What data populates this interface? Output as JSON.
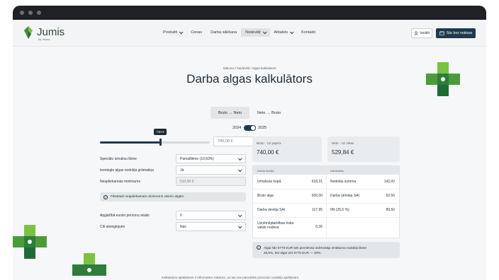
{
  "colors": {
    "navy": "#1e3a4c",
    "green_light": "#7cc242",
    "green_mid": "#4a9c3a",
    "green_dark": "#1f6b35"
  },
  "header": {
    "logo_text": "Jumis",
    "logo_sub": "by Visma",
    "nav": [
      {
        "label": "Produkti",
        "dropdown": true,
        "active": false
      },
      {
        "label": "Cenas",
        "dropdown": false,
        "active": false
      },
      {
        "label": "Darba sākšana",
        "dropdown": false,
        "active": false
      },
      {
        "label": "Nodevēļi",
        "dropdown": true,
        "active": true
      },
      {
        "label": "Atbalsts",
        "dropdown": true,
        "active": false
      },
      {
        "label": "Kontakti",
        "dropdown": false,
        "active": false
      }
    ],
    "login_label": "Ienākt",
    "cta_label": "Sāc bez maksas"
  },
  "hero": {
    "breadcrumb": "Sākums / Nodevēļi / Algas kalkulators",
    "title": "Darba algas kalkulātors"
  },
  "mode": {
    "options": [
      "Bruto → Neto",
      "Neto → Bruto"
    ],
    "selected": 0
  },
  "year_toggle": {
    "left": "2024",
    "right": "2025",
    "on_right": true
  },
  "slider": {
    "bubble": "740 €",
    "fraction": 0.55,
    "input_value": "740,00 €"
  },
  "form": [
    {
      "label": "Speciālo izmaksu likme",
      "value": "Pamatlikme (10,50%)",
      "disabled": false
    },
    {
      "label": "Iesniegts algas nodokļa grāmatiņa",
      "value": "Jā",
      "disabled": false
    },
    {
      "label": "Neapliekamais minimums",
      "value": "510,00 €",
      "disabled": true
    }
  ],
  "form_note": "Fiksētais neapliekamais minimums visiem algām.",
  "form2": [
    {
      "label": "Apgādībā esošo personu skaits",
      "value": "0"
    },
    {
      "label": "Citi atvieglojumi",
      "value": "Nav"
    }
  ],
  "cards": [
    {
      "label": "Bruto · Uz papīra",
      "value": "740,00 €"
    },
    {
      "label": "Neto · Uz rokas",
      "value": "529,84 €"
    }
  ],
  "table": {
    "head_left": "Darba devējs",
    "head_right": "Darbinieks",
    "rows": [
      {
        "l_label": "Izmaksas kopā",
        "l_value": "618,31",
        "r_label": "Nodokļu summa",
        "r_value": "142,00"
      },
      {
        "l_label": "Bruto alga",
        "l_value": "500,00",
        "r_label": "Darba ņēmēja SAI",
        "r_value": "52,50"
      },
      {
        "l_label": "Darba devēja SAI",
        "l_value": "117,95",
        "r_label": "IIN (25,5 %)",
        "r_value": "89,50"
      },
      {
        "l_label": "Uzņēmējdarbības riska valsts nodeva",
        "l_value": "0,36",
        "r_label": "",
        "r_value": ""
      }
    ]
  },
  "salary_note_line1": "Algai līdz 8775 EUR tiek piemērota iedzīvotāju ienākuma nodokļa likme",
  "salary_note_line2": "25,5%, bet algai virs 8775 EUR — 33%.",
  "bottom_text": "Kalkulators aprēķiniem ir informatīvs raksturs, un tas nav paredzēts precīzam nodokļu aprēķinam."
}
